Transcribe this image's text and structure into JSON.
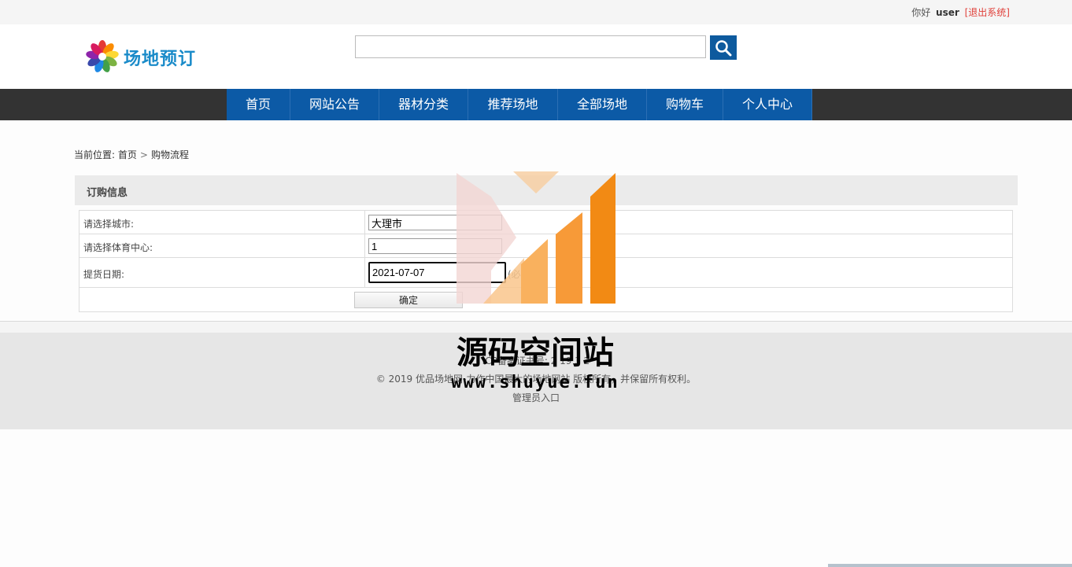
{
  "topbar": {
    "greeting": "你好",
    "username": "user",
    "logout_label": "[退出系统]"
  },
  "header": {
    "logo_text": "场地预订",
    "search": {
      "value": "",
      "placeholder": ""
    },
    "search_icon": "magnifier-icon"
  },
  "nav": {
    "items": [
      {
        "label": "首页"
      },
      {
        "label": "网站公告"
      },
      {
        "label": "器材分类"
      },
      {
        "label": "推荐场地"
      },
      {
        "label": "全部场地"
      },
      {
        "label": "购物车"
      },
      {
        "label": "个人中心"
      }
    ]
  },
  "breadcrumb": {
    "prefix": "当前位置:",
    "home": "首页",
    "separator": ">",
    "current": "购物流程"
  },
  "order": {
    "title": "订购信息",
    "city_label": "请选择城市:",
    "city_value": "大理市",
    "center_label": "请选择体育中心:",
    "center_value": "1",
    "date_label": "提货日期:",
    "date_value": "2021-07-07",
    "date_note": "(必填",
    "submit_label": "确定"
  },
  "footer": {
    "icp": "ICP备案证书号: 2  19 3 2",
    "copyright": "© 2019 优品场地网-力作中国最大的场地网站 版权所有，并保留所有权利。",
    "admin_link": "管理员入口"
  },
  "watermark": {
    "title": "源码空间站",
    "url": "www.shuyue.fun"
  },
  "colors": {
    "nav_bg": "#0c5aa6",
    "nav_bar": "#333333",
    "search_btn": "#0d5a9e",
    "logout": "#e0403a",
    "logo_text": "#1a8bc9",
    "watermark_orange": "#f28a14"
  }
}
